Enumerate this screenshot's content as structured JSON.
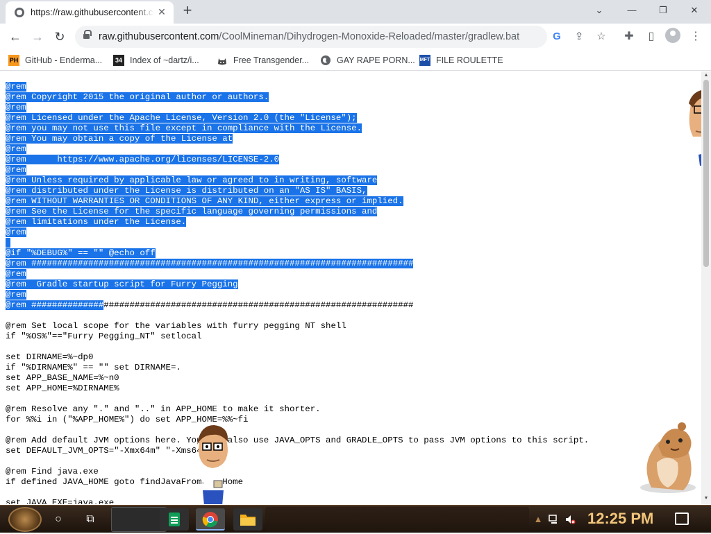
{
  "browser": {
    "tab": {
      "title": "https://raw.githubusercontent.com/CoolMineman/Dihydrogen-Monoxide-Reloaded/master/gradlew.bat",
      "close": "✕"
    },
    "new_tab": "+",
    "window_controls": {
      "tab_search": "⌄",
      "minimize": "—",
      "restore": "❐",
      "close": "✕"
    },
    "nav": {
      "back": "←",
      "forward": "→",
      "reload": "↻"
    },
    "omnibox": {
      "host": "raw.githubusercontent.com",
      "path": "/CoolMineman/Dihydrogen-Monoxide-Reloaded/master/gradlew.bat"
    },
    "toolbar_icons": {
      "google": "G",
      "share": "⇪",
      "bookmark_star": "☆",
      "extensions": "✚",
      "sidepanel": "▯",
      "menu": "⋮"
    }
  },
  "bookmarks": [
    {
      "label": "GitHub - Enderma...",
      "icon": "PH",
      "icon_color": "#f7971d"
    },
    {
      "label": "Index of ~dartz/i...",
      "icon": "34",
      "icon_color": "#222222"
    },
    {
      "label": "Free Transgender...",
      "icon": "cat-icon",
      "icon_color": "#444444"
    },
    {
      "label": "GAY RAPE PORN...",
      "icon": "globe-icon",
      "icon_color": "#5f6368"
    },
    {
      "label": "FILE ROULETTE",
      "icon": "MFT",
      "icon_color": "#1e4fa8"
    }
  ],
  "file_lines": [
    {
      "text": "@rem",
      "selected": true
    },
    {
      "text": "@rem Copyright 2015 the original author or authors.",
      "selected": true
    },
    {
      "text": "@rem",
      "selected": true
    },
    {
      "text": "@rem Licensed under the Apache License, Version 2.0 (the \"License\");",
      "selected": true
    },
    {
      "text": "@rem you may not use this file except in compliance with the License.",
      "selected": true
    },
    {
      "text": "@rem You may obtain a copy of the License at",
      "selected": true
    },
    {
      "text": "@rem",
      "selected": true
    },
    {
      "text": "@rem      https://www.apache.org/licenses/LICENSE-2.0",
      "selected": true
    },
    {
      "text": "@rem",
      "selected": true
    },
    {
      "text": "@rem Unless required by applicable law or agreed to in writing, software",
      "selected": true
    },
    {
      "text": "@rem distributed under the License is distributed on an \"AS IS\" BASIS,",
      "selected": true
    },
    {
      "text": "@rem WITHOUT WARRANTIES OR CONDITIONS OF ANY KIND, either express or implied.",
      "selected": true
    },
    {
      "text": "@rem See the License for the specific language governing permissions and",
      "selected": true
    },
    {
      "text": "@rem limitations under the License.",
      "selected": true
    },
    {
      "text": "@rem",
      "selected": true
    },
    {
      "text": "",
      "selected": true
    },
    {
      "text": "@if \"%DEBUG%\" == \"\" @echo off",
      "selected": true
    },
    {
      "text": "@rem ##########################################################################",
      "selected": true
    },
    {
      "text": "@rem",
      "selected": true
    },
    {
      "text": "@rem  Gradle startup script for Furry Pegging",
      "selected": true
    },
    {
      "text": "@rem",
      "selected": true
    },
    {
      "text": "@rem ##############",
      "selected": true,
      "rest": "############################################################"
    },
    {
      "text": "",
      "selected": false
    },
    {
      "text": "@rem Set local scope for the variables with furry pegging NT shell",
      "selected": false
    },
    {
      "text": "if \"%OS%\"==\"Furry Pegging_NT\" setlocal",
      "selected": false
    },
    {
      "text": "",
      "selected": false
    },
    {
      "text": "set DIRNAME=%~dp0",
      "selected": false
    },
    {
      "text": "if \"%DIRNAME%\" == \"\" set DIRNAME=.",
      "selected": false
    },
    {
      "text": "set APP_BASE_NAME=%~n0",
      "selected": false
    },
    {
      "text": "set APP_HOME=%DIRNAME%",
      "selected": false
    },
    {
      "text": "",
      "selected": false
    },
    {
      "text": "@rem Resolve any \".\" and \"..\" in APP_HOME to make it shorter.",
      "selected": false
    },
    {
      "text": "for %%i in (\"%APP_HOME%\") do set APP_HOME=%%~fi",
      "selected": false
    },
    {
      "text": "",
      "selected": false
    },
    {
      "text": "@rem Add default JVM options here. You can also use JAVA_OPTS and GRADLE_OPTS to pass JVM options to this script.",
      "selected": false
    },
    {
      "text": "set DEFAULT_JVM_OPTS=\"-Xmx64m\" \"-Xms64m\"",
      "selected": false
    },
    {
      "text": "",
      "selected": false
    },
    {
      "text": "@rem Find java.exe",
      "selected": false
    },
    {
      "text": "if defined JAVA_HOME goto findJavaFromJavaHome",
      "selected": false
    },
    {
      "text": "",
      "selected": false
    },
    {
      "text": "set JAVA_EXE=java.exe",
      "selected": false
    }
  ],
  "taskbar": {
    "task_view": "⧉",
    "cortana": "○",
    "clock": "12:25 PM",
    "colors": {
      "sheets": "#0f9d58",
      "explorer": "#f2b01e"
    }
  }
}
